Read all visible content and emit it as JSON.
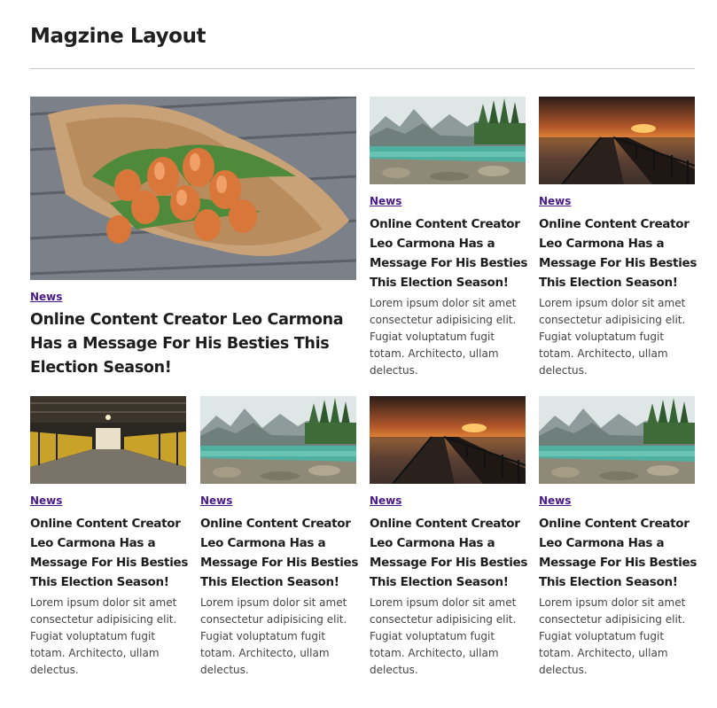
{
  "page": {
    "title": "Magzine Layout"
  },
  "colors": {
    "category_link": "#4a1a8c",
    "divider": "#c9c9c9"
  },
  "featured": {
    "image": "tulip-bouquet-photo",
    "category": "News",
    "headline": "Online Content Creator Leo Carmona Has a Message For His Besties This Election Season!"
  },
  "articles": [
    {
      "image": "mountain-lake-photo",
      "category": "News",
      "headline": "Online Content Creator Leo Carmona Has a Message For His Besties This Election Season!",
      "excerpt": "Lorem ipsum dolor sit amet consectetur adipisicing elit. Fugiat voluptatum fugit totam. Architecto, ullam delectus."
    },
    {
      "image": "sunset-pier-photo",
      "category": "News",
      "headline": "Online Content Creator Leo Carmona Has a Message For His Besties This Election Season!",
      "excerpt": "Lorem ipsum dolor sit amet consectetur adipisicing elit. Fugiat voluptatum fugit totam. Architecto, ullam delectus."
    },
    {
      "image": "industrial-walkway-photo",
      "category": "News",
      "headline": "Online Content Creator Leo Carmona Has a Message For His Besties This Election Season!",
      "excerpt": "Lorem ipsum dolor sit amet consectetur adipisicing elit. Fugiat voluptatum fugit totam. Architecto, ullam delectus."
    },
    {
      "image": "mountain-lake-photo",
      "category": "News",
      "headline": "Online Content Creator Leo Carmona Has a Message For His Besties This Election Season!",
      "excerpt": "Lorem ipsum dolor sit amet consectetur adipisicing elit. Fugiat voluptatum fugit totam. Architecto, ullam delectus."
    },
    {
      "image": "sunset-pier-photo",
      "category": "News",
      "headline": "Online Content Creator Leo Carmona Has a Message For His Besties This Election Season!",
      "excerpt": "Lorem ipsum dolor sit amet consectetur adipisicing elit. Fugiat voluptatum fugit totam. Architecto, ullam delectus."
    },
    {
      "image": "mountain-lake-photo",
      "category": "News",
      "headline": "Online Content Creator Leo Carmona Has a Message For His Besties This Election Season!",
      "excerpt": "Lorem ipsum dolor sit amet consectetur adipisicing elit. Fugiat voluptatum fugit totam. Architecto, ullam delectus."
    }
  ]
}
